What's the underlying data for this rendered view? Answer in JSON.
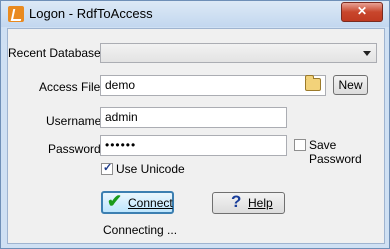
{
  "window": {
    "title": "Logon - RdfToAccess",
    "close_label": "✕"
  },
  "form": {
    "recent_label": "Recent Databases",
    "recent_value": "",
    "access_label": "Access File",
    "access_value": "demo",
    "new_label": "New",
    "username_label": "Username",
    "username_value": "admin",
    "password_label": "Password",
    "password_value": "••••••",
    "save_password_label": "Save Password",
    "save_password_checked": false,
    "unicode_label": "Use Unicode",
    "unicode_checked": true,
    "connect_label": "Connect",
    "help_label": "Help",
    "status": "Connecting ..."
  },
  "icons": {
    "app": "rdf-app-icon",
    "folder": "folder-open-icon",
    "connect": "green-check-icon",
    "help": "question-mark-icon"
  }
}
